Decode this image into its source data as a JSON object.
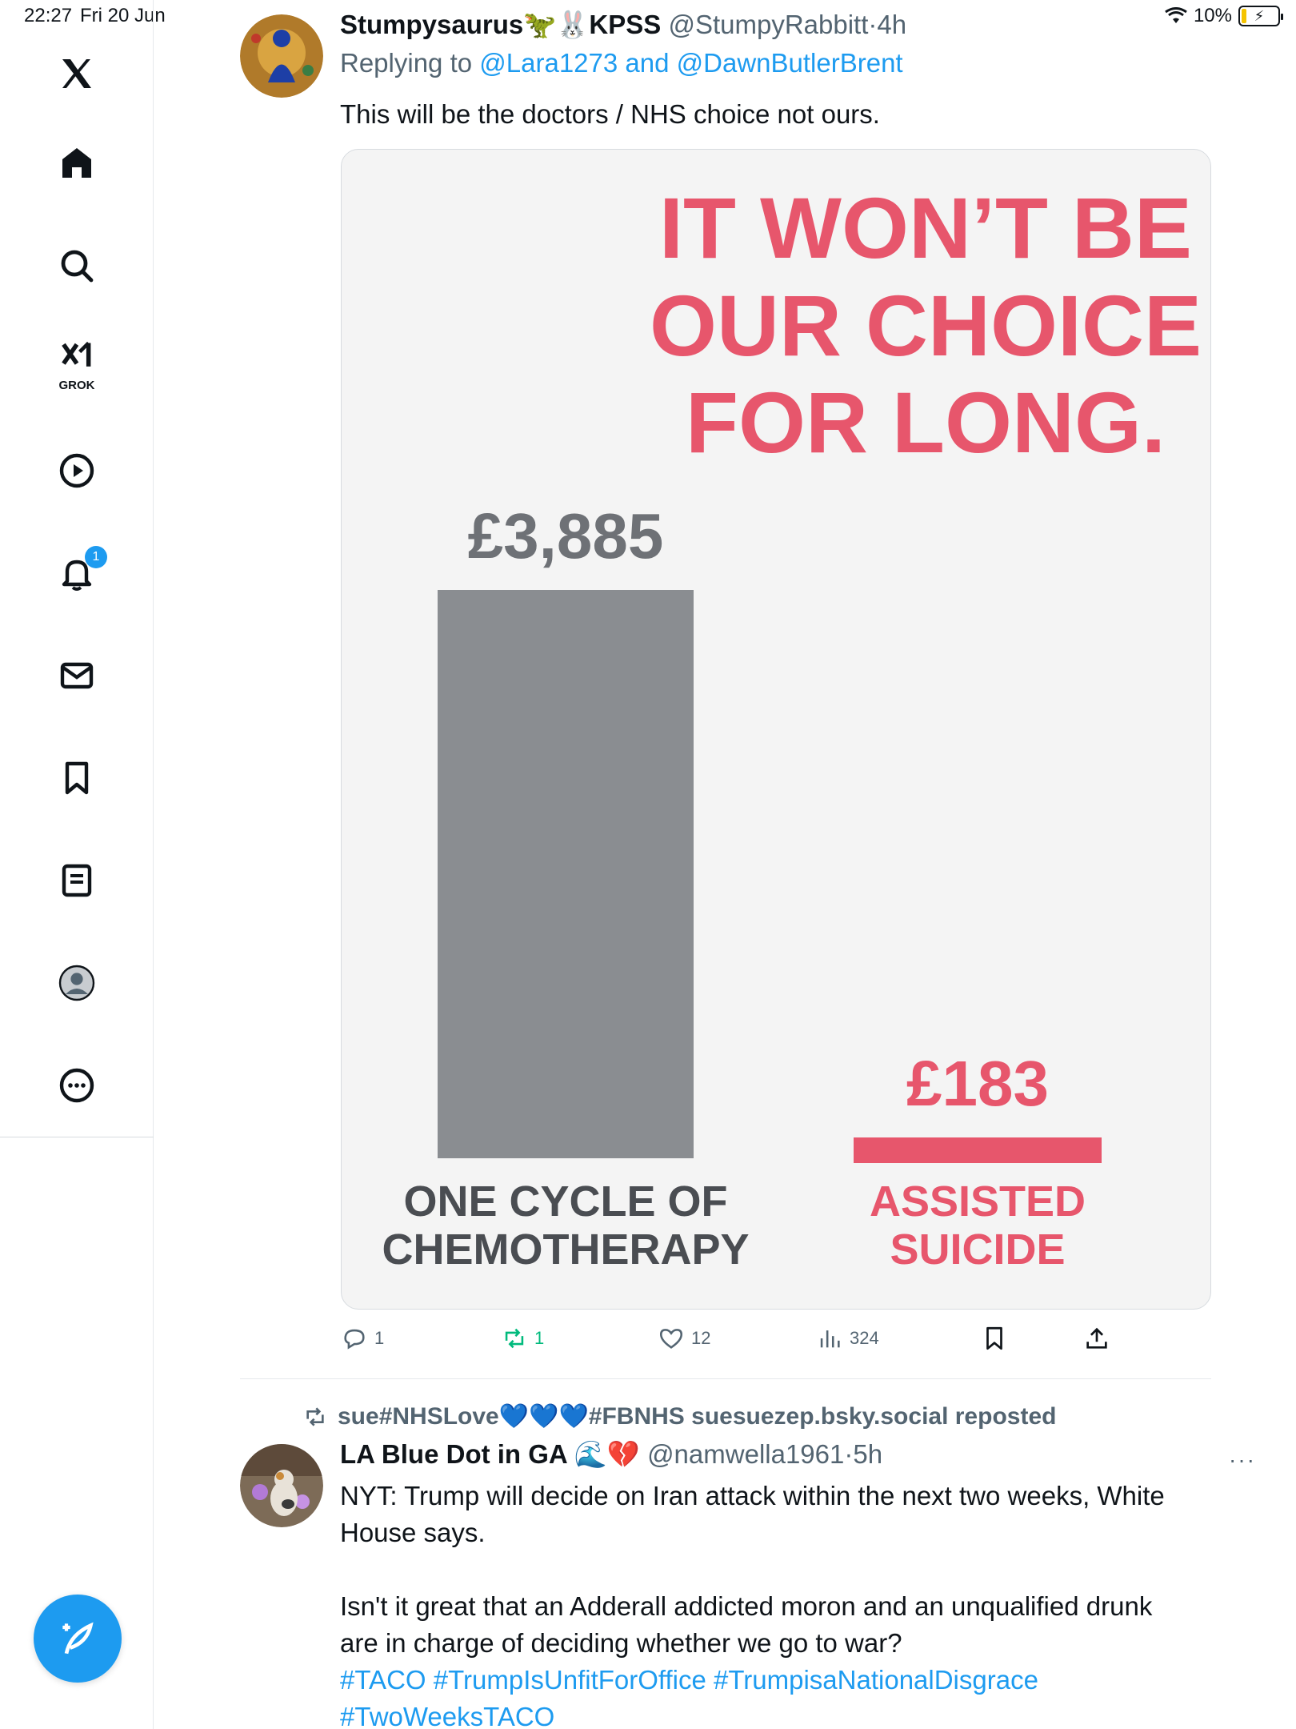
{
  "status_bar": {
    "time": "22:27",
    "date": "Fri 20 Jun",
    "battery": "10%"
  },
  "sidebar": {
    "items": [
      {
        "name": "x-logo-icon"
      },
      {
        "name": "home-icon"
      },
      {
        "name": "search-icon"
      },
      {
        "name": "grok-icon",
        "label": "GROK"
      },
      {
        "name": "video-icon"
      },
      {
        "name": "notifications-icon",
        "badge": "1"
      },
      {
        "name": "messages-icon"
      },
      {
        "name": "bookmarks-icon"
      },
      {
        "name": "lists-icon"
      },
      {
        "name": "profile-icon"
      },
      {
        "name": "more-icon"
      }
    ],
    "compose_icon": "compose-icon"
  },
  "tweet1": {
    "display_name": "Stumpysaurus🦖🐰KPSS",
    "handle": "@StumpyRabbitt",
    "time": "4h",
    "replying_prefix": "Replying to",
    "replying_to": "@Lara1273 and @DawnButlerBrent",
    "text": "This will be the doctors / NHS choice not ours.",
    "counts": {
      "replies": "1",
      "reposts": "1",
      "likes": "12",
      "views": "324"
    }
  },
  "chart_data": {
    "type": "bar",
    "title": "IT WON’T BE OUR CHOICE FOR LONG.",
    "categories": [
      "ONE CYCLE OF CHEMOTHERAPY",
      "ASSISTED SUICIDE"
    ],
    "values": [
      3885,
      183
    ],
    "value_labels": [
      "£3,885",
      "£183"
    ],
    "colors": [
      "#8a8d91",
      "#e7566c"
    ],
    "xlabel": "",
    "ylabel": "",
    "ylim": [
      0,
      3885
    ],
    "grid": false
  },
  "chart_text": {
    "title_lines": [
      "IT WON’T BE",
      "OUR CHOICE",
      "FOR LONG."
    ],
    "cat1_lines": [
      "ONE CYCLE OF",
      "CHEMOTHERAPY"
    ],
    "cat2_lines": [
      "ASSISTED",
      "SUICIDE"
    ]
  },
  "tweet2": {
    "repost_text": "sue#NHSLove💙💙💙#FBNHS suesuezep.bsky.social reposted",
    "display_name": "LA Blue Dot in GA 🌊💔",
    "handle": "@namwella1961",
    "time": "5h",
    "more": "···",
    "text_lines": [
      "NYT: Trump will decide on Iran attack within the next two weeks, White",
      "House says.",
      "",
      "Isn't it great that an Adderall addicted moron and an unqualified drunk",
      "are in charge of deciding whether we go to war?"
    ],
    "hashtags_line1": "#TACO #TrumpIsUnfitForOffice #TrumpisaNationalDisgrace",
    "hashtags_line2": "#TwoWeeksTACO"
  },
  "colors": {
    "accent": "#1d9bf0",
    "repost_green": "#00ba7c",
    "muted": "#536471",
    "chart_red": "#e7566c",
    "chart_grey": "#8a8d91"
  }
}
